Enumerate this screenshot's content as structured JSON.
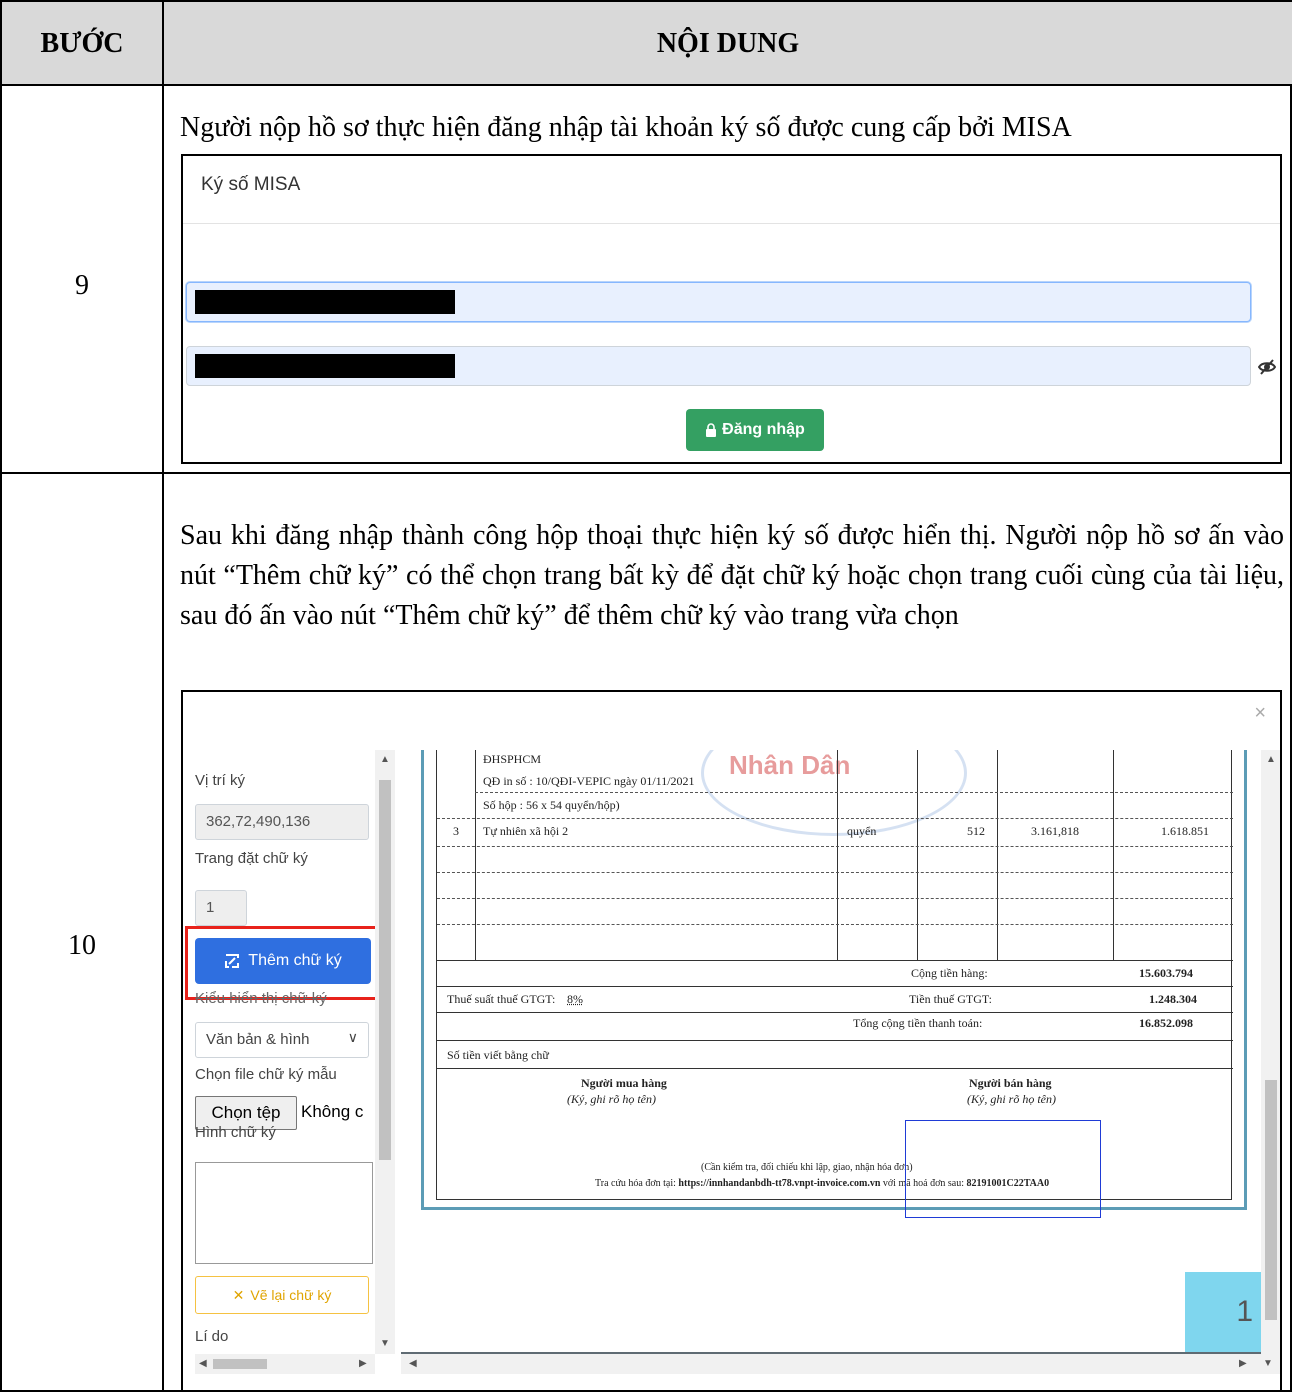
{
  "table": {
    "header_step": "BƯỚC",
    "header_content": "NỘI DUNG"
  },
  "rows": [
    {
      "step": "9",
      "description": "Người  nộp hồ sơ thực hiện đăng nhập tài khoản ký số được cung cấp bởi MISA",
      "screenshot": {
        "title": "Ký số MISA",
        "login_button": "Đăng nhập",
        "icons": [
          "eye-slash-icon",
          "lock-icon"
        ]
      }
    },
    {
      "step": "10",
      "description": "Sau khi đăng nhập thành công hộp thoại thực hiện ký số được hiển thị. Người nộp hồ sơ ấn vào nút “Thêm chữ ký” có thể chọn trang bất kỳ để đặt chữ ký hoặc chọn trang cuối cùng của tài liệu, sau đó ấn vào nút “Thêm chữ ký” để thêm chữ ký vào trang vừa chọn",
      "screenshot": {
        "close": "×",
        "sign_position_label": "Vị trí ký",
        "sign_position_value": "362,72,490,136",
        "sign_page_label": "Trang đặt chữ ký",
        "sign_page_value": "1",
        "add_signature_button": "Thêm chữ ký",
        "display_type_label": "Kiểu hiển thị chữ ký",
        "display_type_value": "Văn bản & hình",
        "sample_file_label": "Chọn file chữ ký mẫu",
        "choose_file_button": "Chọn tệp",
        "no_file_text": "Không c",
        "signature_image_label": "Hình chữ ký",
        "redraw_button": "Vẽ lại chữ ký",
        "reason_label": "Lí do",
        "page_number": "1",
        "invoice": {
          "watermark": "Nhân Dân",
          "line1": "ĐHSPHCM",
          "line2": "QĐ in số : 10/QĐI-VEPIC ngày 01/11/2021",
          "line3": "Số hộp : 56 x 54 quyển/hộp)",
          "row_no": "3",
          "row_name": "Tự nhiên xã hội 2",
          "row_unit": "quyển",
          "row_qty": "512",
          "row_price": "3.161,818",
          "row_amount": "1.618.851",
          "subtotal_label": "Cộng tiền hàng:",
          "subtotal_value": "15.603.794",
          "vat_rate_label": "Thuế suất thuế GTGT:",
          "vat_rate_value": "8%",
          "vat_label": "Tiền thuế GTGT:",
          "vat_value": "1.248.304",
          "total_label": "Tổng cộng tiền thanh toán:",
          "total_value": "16.852.098",
          "words_label": "Số tiền viết bằng chữ",
          "buyer_title": "Người mua hàng",
          "buyer_note": "(Ký, ghi rõ họ tên)",
          "seller_title": "Người bán hàng",
          "seller_note": "(Ký, ghi rõ họ tên)",
          "footer1": "(Cần kiểm tra, đối chiếu khi lập, giao, nhận hóa đơn)",
          "footer2_prefix": "Tra cứu hóa đơn tại:",
          "footer2_url": "https://innhandanbdh-tt78.vnpt-invoice.com.vn",
          "footer2_mid": "với mã hoá đơn sau:",
          "footer2_code": "82191001C22TAA0"
        }
      }
    }
  ]
}
